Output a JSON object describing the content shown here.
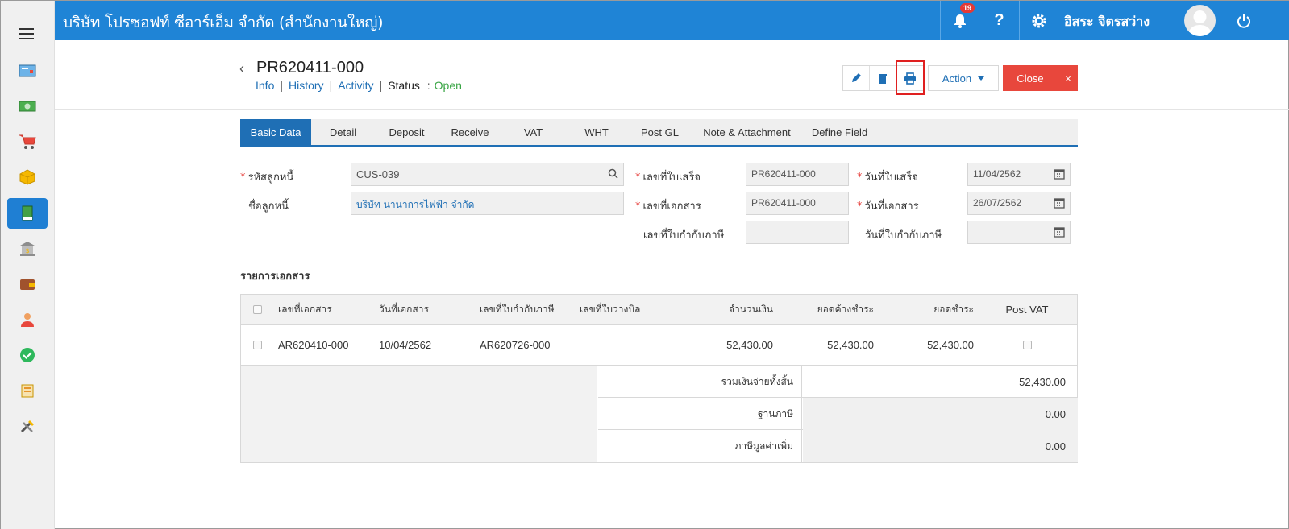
{
  "app": {
    "company": "บริษัท โปรซอฟท์ ซีอาร์เอ็ม จำกัด (สำนักงานใหญ่)",
    "notification_count": "19",
    "help_label": "?",
    "username": "อิสระ จิตรสว่าง",
    "accent_color": "#1f84d6"
  },
  "sidebar": {
    "items": [
      {
        "icon": "dashboard-icon"
      },
      {
        "icon": "money-icon"
      },
      {
        "icon": "cart-icon"
      },
      {
        "icon": "box-icon"
      },
      {
        "icon": "ledger-book-icon",
        "active": true
      },
      {
        "icon": "bank-icon"
      },
      {
        "icon": "wallet-icon"
      },
      {
        "icon": "people-icon"
      },
      {
        "icon": "check-circle-icon"
      },
      {
        "icon": "transfer-icon"
      },
      {
        "icon": "tools-icon"
      }
    ]
  },
  "header": {
    "doc_number": "PR620411-000",
    "links": [
      "Info",
      "History",
      "Activity"
    ],
    "status_label": "Status",
    "status_sep": ":",
    "status_value": "Open",
    "action_label": "Action",
    "close_label": "Close",
    "close_x": "×"
  },
  "tabs": [
    "Basic Data",
    "Detail",
    "Deposit",
    "Receive",
    "VAT",
    "WHT",
    "Post GL",
    "Note & Attachment",
    "Define Field"
  ],
  "form": {
    "req_mark": "*",
    "debtor_code_label": "รหัสลูกหนี้",
    "debtor_code": "CUS-039",
    "debtor_name_label": "ชื่อลูกหนี้",
    "debtor_name": "บริษัท นานาการไฟฟ้า จำกัด",
    "receipt_no_label": "เลขที่ใบเสร็จ",
    "receipt_no": "PR620411-000",
    "doc_no_label": "เลขที่เอกสาร",
    "doc_no": "PR620411-000",
    "tax_invoice_no_label": "เลขที่ใบกำกับภาษี",
    "tax_invoice_no": "",
    "receipt_date_label": "วันที่ใบเสร็จ",
    "receipt_date": "11/04/2562",
    "doc_date_label": "วันที่เอกสาร",
    "doc_date": "26/07/2562",
    "tax_invoice_date_label": "วันที่ใบกำกับภาษี",
    "tax_invoice_date": ""
  },
  "documents": {
    "title": "รายการเอกสาร",
    "columns": [
      "เลขที่เอกสาร",
      "วันที่เอกสาร",
      "เลขที่ใบกำกับภาษี",
      "เลขที่ใบวางบิล",
      "จำนวนเงิน",
      "ยอดค้างชำระ",
      "ยอดชำระ",
      "Post VAT"
    ],
    "rows": [
      {
        "doc_no": "AR620410-000",
        "doc_date": "10/04/2562",
        "tax_invoice": "AR620726-000",
        "billing_no": "",
        "amount": "52,430.00",
        "outstanding": "52,430.00",
        "paid": "52,430.00",
        "post_vat": false
      }
    ],
    "summary": [
      {
        "label": "รวมเงินจ่ายทั้งสิ้น",
        "value": "52,430.00"
      },
      {
        "label": "ฐานภาษี",
        "value": "0.00"
      },
      {
        "label": "ภาษีมูลค่าเพิ่ม",
        "value": "0.00"
      }
    ]
  }
}
